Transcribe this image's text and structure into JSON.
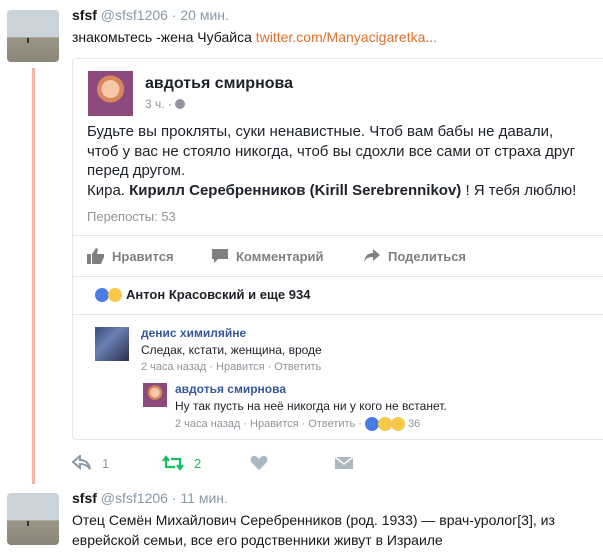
{
  "tweet1": {
    "name": "sfsf",
    "handle": "@sfsf1206",
    "sep": "·",
    "time": "20 мин.",
    "text": "знакомьтесь -жена  Чубайса ",
    "link": "twitter.com/Manyacigaretka..."
  },
  "card": {
    "author": "авдотья смирнова",
    "time": "3 ч. ·",
    "body_line1": "Будьте вы прокляты, суки ненавистные. Чтоб вам бабы не давали,",
    "body_line2": "чтоб у вас не стояло никогда, чтоб вы сдохли все сами от страха друг",
    "body_line3": "перед другом.",
    "body_kira": "Кира. ",
    "body_mention": "Кирилл Серебренников (Kirill Serebrennikov)",
    "body_tail": " ! Я тебя люблю!",
    "reposts": "Перепосты: 53",
    "actions": {
      "like": "Нравится",
      "comment": "Комментарий",
      "share": "Поделиться"
    },
    "reactions_text": "Антон Красовский и еще 934",
    "comment1": {
      "name": "денис химиляйне",
      "text": "Следак, кстати, женщина, вроде",
      "time": "2 часа назад",
      "like": "Нравится",
      "reply": "Ответить",
      "dot": "·"
    },
    "comment2": {
      "name": "авдотья смирнова",
      "text": "Ну так пусть на неё никогда ни у кого не встанет.",
      "time": "2 часа назад",
      "like": "Нравится",
      "reply": "Ответить",
      "count": "36",
      "dot": "·"
    }
  },
  "tweet1_actions": {
    "reply_count": "1",
    "retweet_count": "2"
  },
  "tweet2": {
    "name": "sfsf",
    "handle": "@sfsf1206",
    "sep": "·",
    "time": "11 мин.",
    "text_line1": "Отец Семён Михайлович Серебренников (род. 1933) — врач-уролог[3], из",
    "text_line2": "еврейской семьи, все его родственники живут в Израиле"
  },
  "colors": {
    "link": "#e0702a",
    "retweet": "#17bf63",
    "thread": "#f4b6a0",
    "fb_blue": "#365899"
  }
}
